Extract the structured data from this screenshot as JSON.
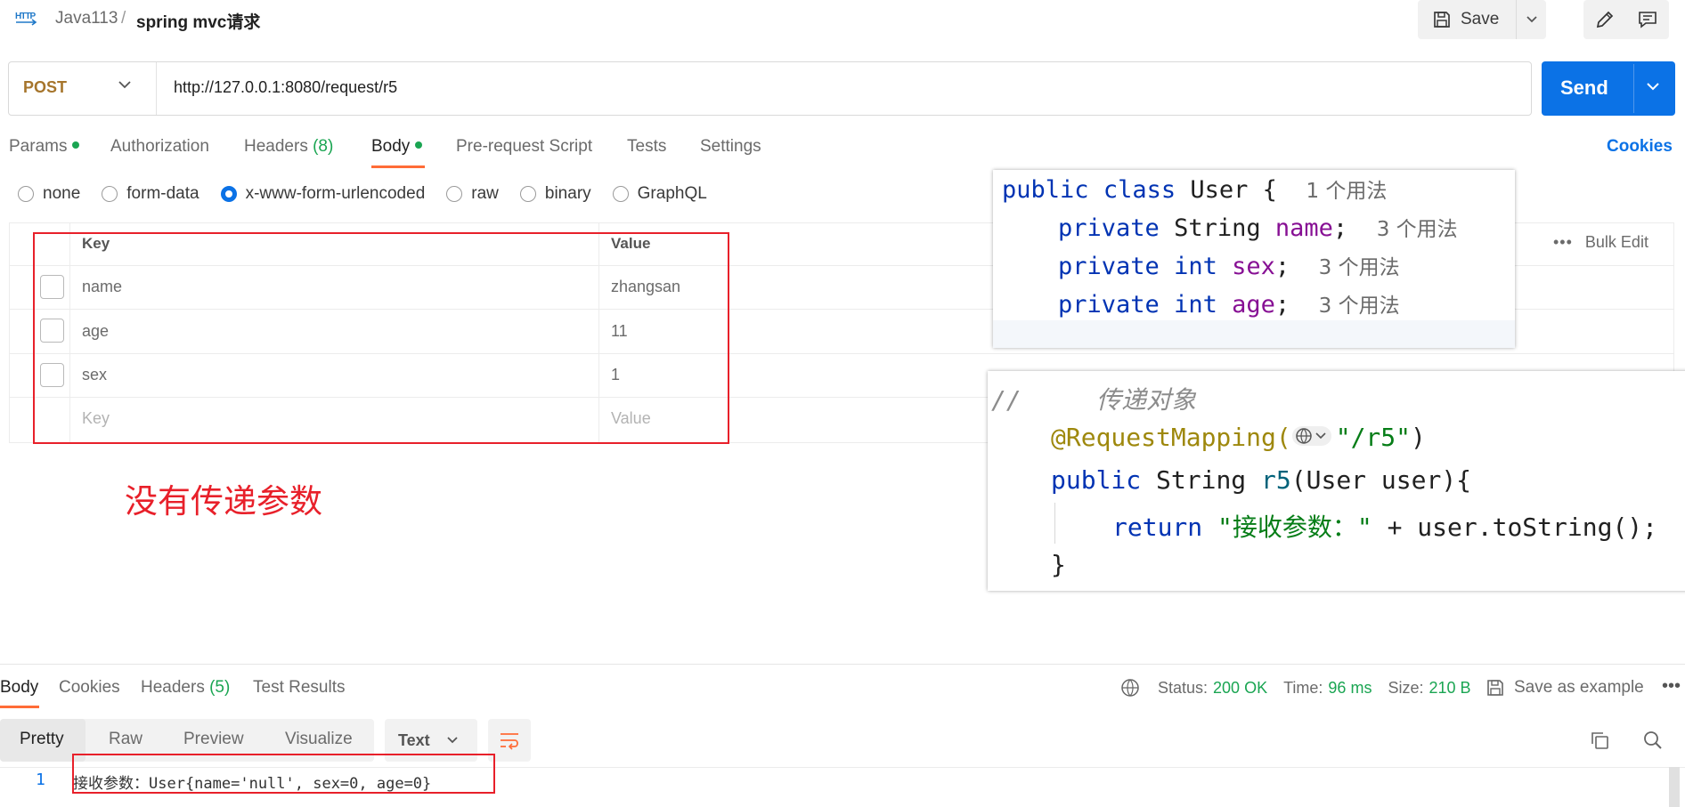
{
  "header": {
    "logo_text": "HTTP",
    "breadcrumb_parent": "Java113",
    "breadcrumb_sep": "/",
    "breadcrumb_current": "spring mvc请求",
    "save_label": "Save"
  },
  "request": {
    "method": "POST",
    "url": "http://127.0.0.1:8080/request/r5",
    "send_label": "Send",
    "tabs": [
      {
        "label": "Params",
        "dot": true
      },
      {
        "label": "Authorization"
      },
      {
        "label": "Headers",
        "count": "(8)"
      },
      {
        "label": "Body",
        "dot": true,
        "active": true
      },
      {
        "label": "Pre-request Script"
      },
      {
        "label": "Tests"
      },
      {
        "label": "Settings"
      }
    ],
    "cookies_label": "Cookies",
    "body_types": [
      "none",
      "form-data",
      "x-www-form-urlencoded",
      "raw",
      "binary",
      "GraphQL"
    ],
    "body_type_selected": "x-www-form-urlencoded",
    "table": {
      "key_header": "Key",
      "value_header": "Value",
      "rows": [
        {
          "key": "name",
          "value": "zhangsan"
        },
        {
          "key": "age",
          "value": "11"
        },
        {
          "key": "sex",
          "value": "1"
        }
      ],
      "key_placeholder": "Key",
      "value_placeholder": "Value",
      "bulk_edit": "Bulk Edit"
    }
  },
  "annotation": {
    "note": "没有传递参数"
  },
  "code_snippet_user": {
    "line1": {
      "kw1": "public",
      "kw2": "class",
      "name": "User",
      "brace": "{",
      "hint": "1 个用法"
    },
    "fields": [
      {
        "mod": "private",
        "type": "String",
        "name": "name",
        "hint": "3 个用法"
      },
      {
        "mod": "private",
        "type": "int",
        "name": "sex",
        "hint": "3 个用法"
      },
      {
        "mod": "private",
        "type": "int",
        "name": "age",
        "hint": "3 个用法"
      }
    ]
  },
  "code_snippet_controller": {
    "comment": "//     传递对象",
    "annotation": "@RequestMapping(",
    "path": "\"/r5\"",
    "close_paren": ")",
    "sig_public": "public",
    "sig_type": "String",
    "sig_name": "r5",
    "sig_rest": "(User user){",
    "ret_kw": "return",
    "ret_str": "\"接收参数：\"",
    "ret_rest": " + user.toString();",
    "end_brace": "}"
  },
  "response": {
    "tabs": [
      {
        "label": "Body",
        "active": true
      },
      {
        "label": "Cookies"
      },
      {
        "label": "Headers",
        "count": "(5)"
      },
      {
        "label": "Test Results"
      }
    ],
    "status_label": "Status:",
    "status_value": "200 OK",
    "time_label": "Time:",
    "time_value": "96 ms",
    "size_label": "Size:",
    "size_value": "210 B",
    "save_example": "Save as example",
    "formats": [
      "Pretty",
      "Raw",
      "Preview",
      "Visualize"
    ],
    "format_selected": "Pretty",
    "text_type": "Text",
    "line_number": "1",
    "body_text": "接收参数：User{name='null', sex=0, age=0}"
  },
  "colors": {
    "accent_blue": "#0b72e6",
    "tab_underline": "#ff6c37",
    "dot_green": "#1aa552",
    "annotation_red": "#e8202a",
    "method_post": "#a6752c"
  }
}
